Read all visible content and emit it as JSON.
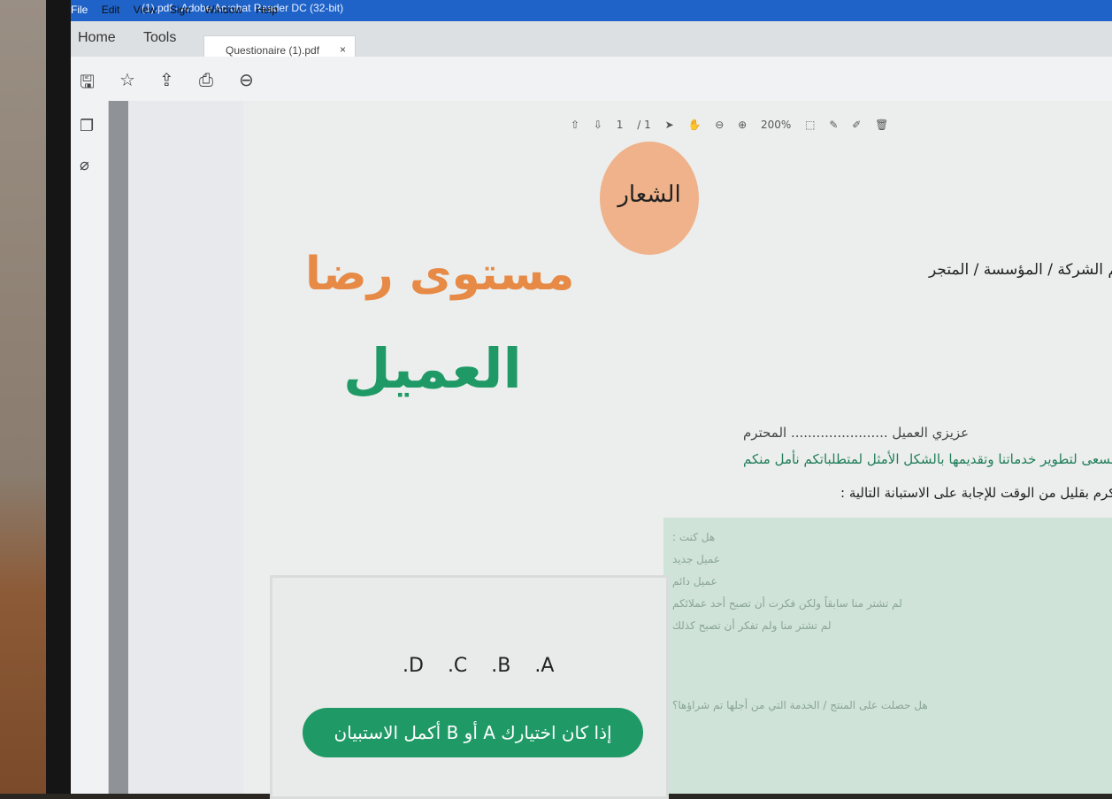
{
  "window": {
    "title": "(1).pdf - Adobe Acrobat Reader DC (32-bit)"
  },
  "menu": [
    "File",
    "Edit",
    "View",
    "Sign",
    "Window",
    "Help"
  ],
  "nav_tabs": [
    "Home",
    "Tools"
  ],
  "doc_tab": {
    "label": "Questionaire (1).pdf",
    "close": "×"
  },
  "viewbar": {
    "page_current": "1",
    "page_total": "/ 1",
    "zoom": "200%"
  },
  "document": {
    "logo_text": "الشعار",
    "title_line1": "مستوى رضا",
    "title_line2": "العميل",
    "company_line": "اسم الشركة / المؤسسة / المتجر",
    "greeting": "عزيزي العميل ....................... المحترم",
    "intro_line1": "نسعى لتطوير خدماتنا وتقديمها بالشكل الأمثل لمتطلباتكم نأمل منكم",
    "intro_line2": "التكرم بقليل من الوقت للإجابة على الاستبانة التالية :",
    "question_lines": [
      "هل كنت :",
      "عميل جديد",
      "عميل دائم",
      "لم تشتر منا سابقاً ولكن فكرت أن تصبح أحد عملائكم",
      "لم تشتر منا ولم تفكر أن تصبح كذلك"
    ],
    "question2": "هل حصلت على المنتج / الخدمة التي من أجلها تم شراؤها؟",
    "options": [
      ".D",
      ".C",
      ".B",
      ".A"
    ],
    "instruction": "إذا كان اختيارك A أو B أكمل الاستبيان"
  },
  "colors": {
    "accent_orange": "#e68a46",
    "accent_green": "#1f9a66",
    "logo_circle": "#efb28a",
    "title_bar": "#1f63c9"
  }
}
